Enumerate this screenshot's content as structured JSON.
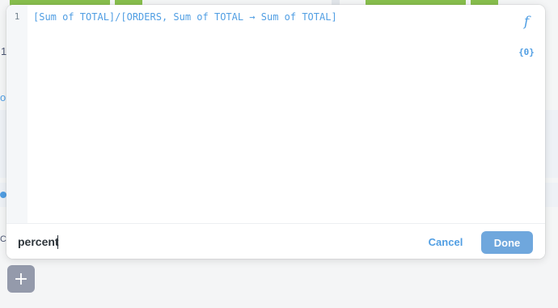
{
  "editor": {
    "line_number": "1",
    "expression": "[Sum of TOTAL]/[ORDERS, Sum of TOTAL → Sum of TOTAL]",
    "function_icon": "function-f-icon",
    "variable_icon": "variable-braces-icon",
    "function_glyph": "f",
    "variable_glyph": "{0}"
  },
  "footer": {
    "name_value": "percent",
    "cancel_label": "Cancel",
    "done_label": "Done"
  },
  "background": {
    "add_button_glyph": "+",
    "fragments": [
      "1",
      "o",
      "Cu"
    ]
  },
  "colors": {
    "accent": "#509ee3",
    "done_button": "#6fa7dd",
    "pill_green": "#88bf4d",
    "add_button": "#949aab"
  }
}
